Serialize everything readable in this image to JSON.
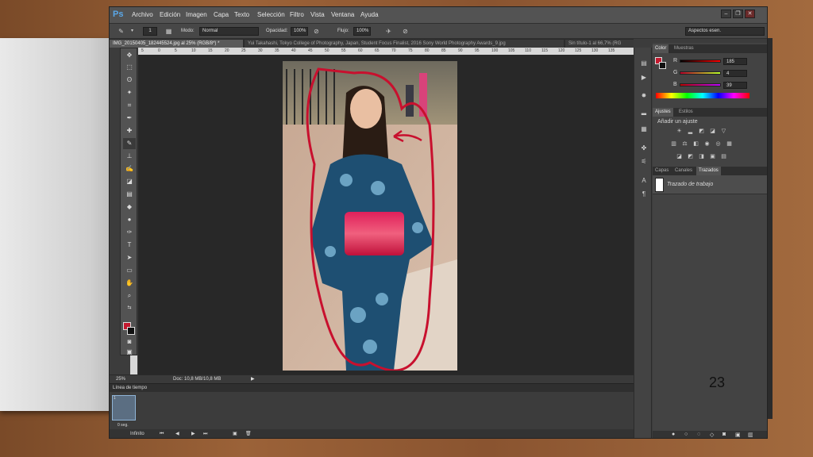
{
  "app": {
    "logo": "Ps"
  },
  "menu": [
    "Archivo",
    "Edición",
    "Imagen",
    "Capa",
    "Texto",
    "Selección",
    "Filtro",
    "Vista",
    "Ventana",
    "Ayuda"
  ],
  "window_controls": [
    "–",
    "❐",
    "✕"
  ],
  "options_bar": {
    "brush_size": "1",
    "mode_label": "Modo:",
    "mode_value": "Normal",
    "opacity_label": "Opacidad:",
    "opacity_value": "100%",
    "flow_label": "Flujo:",
    "flow_value": "100%",
    "workspace": "Aspectos esen."
  },
  "tabs": [
    {
      "label": "IMG_20150405_182445524.jpg al 25% (RGB/8*) *",
      "active": true
    },
    {
      "label": "Yui Takahashi, Tokyo College of Photography, Japan, Student Focus Finalist, 2016 Sony World Photography Awards_9.jpg",
      "active": false
    },
    {
      "label": "Sin título-1 al 66,7% (RG",
      "active": false
    }
  ],
  "ruler_ticks": [
    "5",
    "0",
    "5",
    "10",
    "15",
    "20",
    "25",
    "30",
    "35",
    "40",
    "45",
    "50",
    "55",
    "60",
    "65",
    "70",
    "75",
    "80",
    "85",
    "90",
    "95",
    "100",
    "105",
    "110",
    "115",
    "120",
    "125",
    "130",
    "135"
  ],
  "status": {
    "zoom": "25%",
    "doc": "Doc: 10,8 MB/10,8 MB"
  },
  "timeline": {
    "title": "Línea de tiempo",
    "frame_number": "1",
    "frame_delay": "0 seg.",
    "loop": "Infinito"
  },
  "color_panel": {
    "tabs": [
      "Color",
      "Muestras"
    ],
    "r_label": "R",
    "r_value": "185",
    "g_label": "G",
    "g_value": "4",
    "b_label": "B",
    "b_value": "39",
    "foreground": "#c3192f",
    "background": "#111111"
  },
  "adjust_panel": {
    "tabs": [
      "Ajustes",
      "Estilos"
    ],
    "title": "Añadir un ajuste"
  },
  "layers_panel": {
    "tabs": [
      "Capas",
      "Canales",
      "Trazados"
    ],
    "path_name": "Trazado de trabajo"
  },
  "page_number": "23",
  "colors": {
    "accent_blue": "#5aa7e8",
    "annotation_red": "#c8102e"
  }
}
